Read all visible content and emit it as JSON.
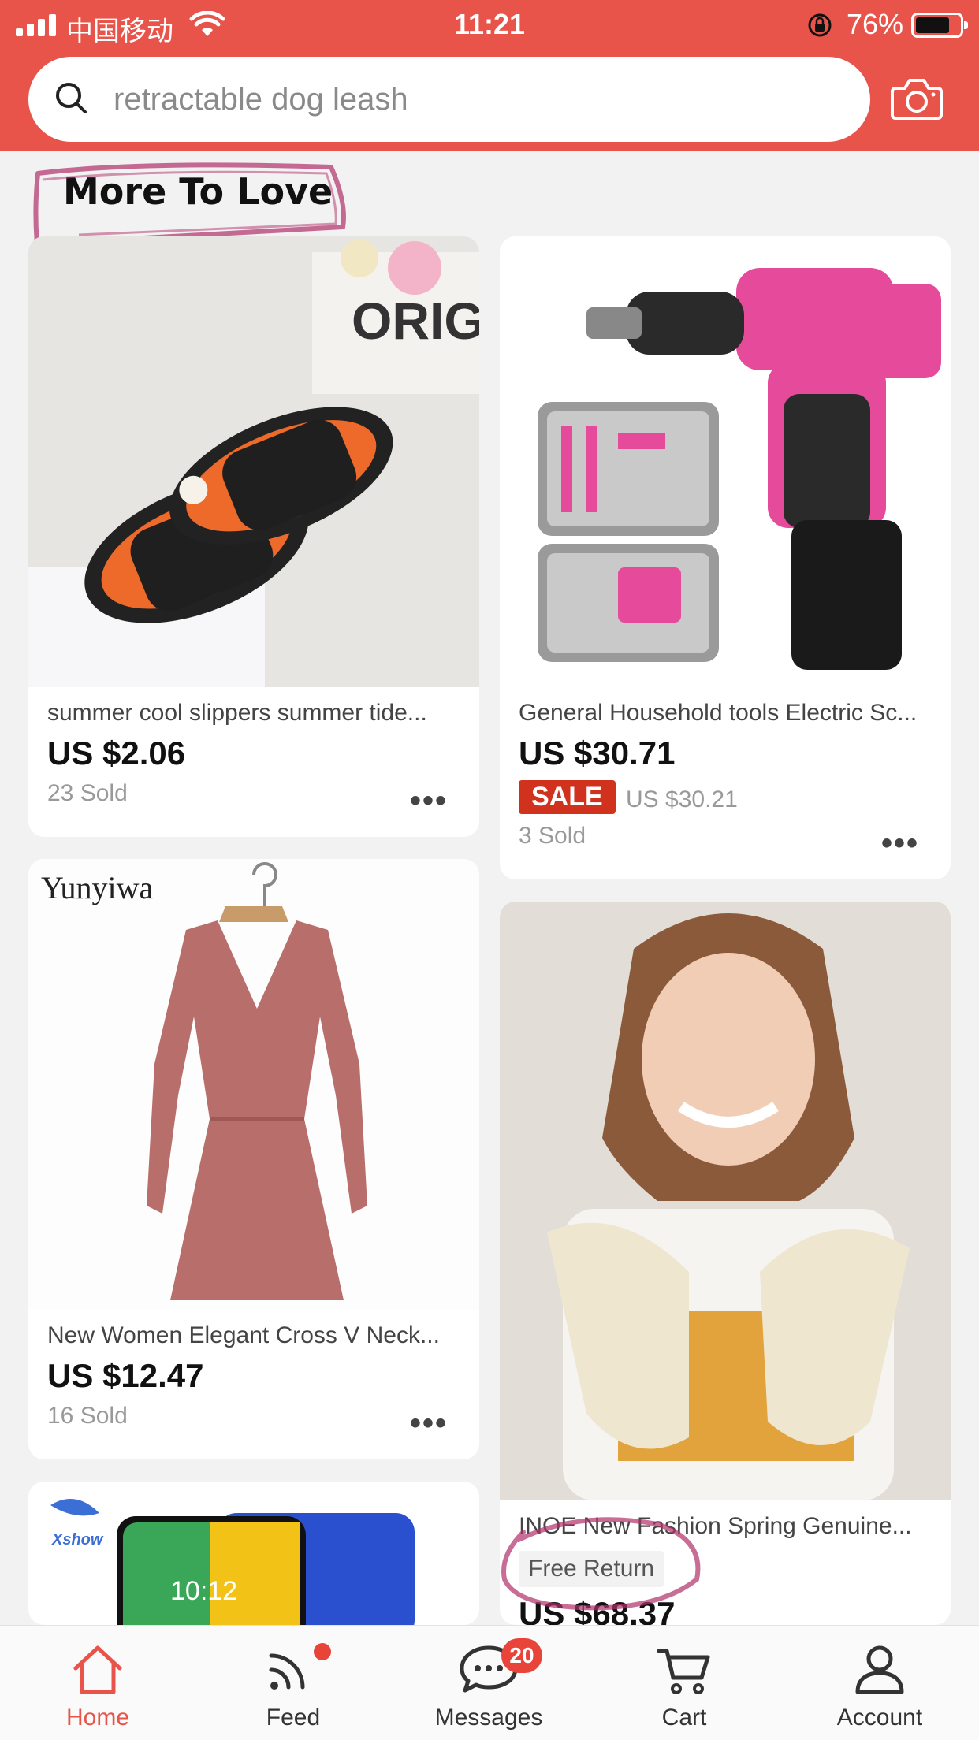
{
  "status_bar": {
    "carrier": "中国移动",
    "time": "11:21",
    "battery": "76%",
    "battery_level": 0.76
  },
  "search": {
    "placeholder": "retractable dog leash"
  },
  "section": {
    "title": "More To Love"
  },
  "products": [
    {
      "title": "summer cool slippers summer tide...",
      "price": "US $2.06",
      "sold": "23 Sold",
      "more": "•••"
    },
    {
      "title": "General Household tools Electric Sc...",
      "price": "US $30.71",
      "sale_label": "SALE",
      "original_price": "US $30.21",
      "sold": "3 Sold",
      "more": "•••"
    },
    {
      "title": "New Women Elegant Cross V Neck...",
      "price": "US $12.47",
      "sold": "16 Sold",
      "more": "•••",
      "brand": "Yunyiwa"
    },
    {
      "title": "INOE New Fashion Spring Genuine...",
      "tag": "Free Return",
      "price": "US $68.37"
    },
    {
      "brand": "Xshow",
      "phone_time": "10:12"
    }
  ],
  "images": {
    "slippers_sign": "ORIG"
  },
  "tabs": [
    {
      "label": "Home",
      "icon": "home-icon",
      "active": true
    },
    {
      "label": "Feed",
      "icon": "feed-icon",
      "has_dot": true
    },
    {
      "label": "Messages",
      "icon": "messages-icon",
      "badge": "20"
    },
    {
      "label": "Cart",
      "icon": "cart-icon"
    },
    {
      "label": "Account",
      "icon": "account-icon"
    }
  ],
  "colors": {
    "accent": "#e8544a",
    "sale": "#d0321d",
    "annotation": "#b0306a"
  }
}
